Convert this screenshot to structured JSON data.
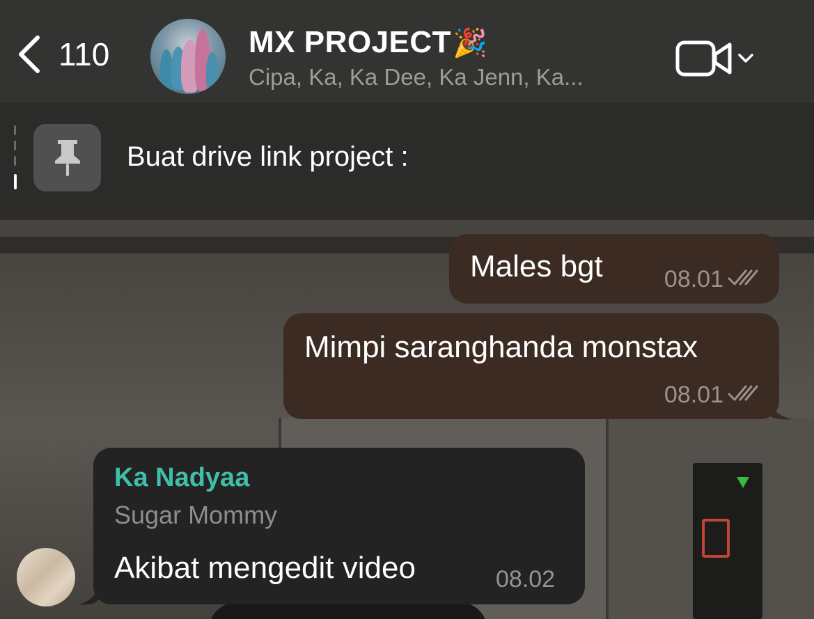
{
  "header": {
    "back_count": "110",
    "title": "MX PROJECT",
    "title_emoji": "🎉",
    "members": "Cipa, Ka, Ka Dee, Ka Jenn, Ka..."
  },
  "pinned": {
    "text": "Buat drive link project :"
  },
  "messages": [
    {
      "direction": "outgoing",
      "text": "Males bgt",
      "time": "08.01"
    },
    {
      "direction": "outgoing",
      "text": "Mimpi saranghanda monstax",
      "time": "08.01"
    },
    {
      "direction": "incoming",
      "sender": "Ka Nadyaa",
      "sender_title": "Sugar Mommy",
      "text": "Akibat mengedit video",
      "time": "08.02"
    }
  ],
  "colors": {
    "header_bg": "#333331",
    "pinned_bg": "#2b2b2a",
    "outgoing_bubble": "#3c2b22",
    "incoming_bubble": "#232323",
    "sender_name": "#3fbfa8"
  },
  "icons": {
    "back": "chevron-left-icon",
    "pin": "pin-icon",
    "video_call": "video-camera-icon",
    "video_menu": "chevron-down-icon",
    "read_receipt": "double-check-icon"
  }
}
